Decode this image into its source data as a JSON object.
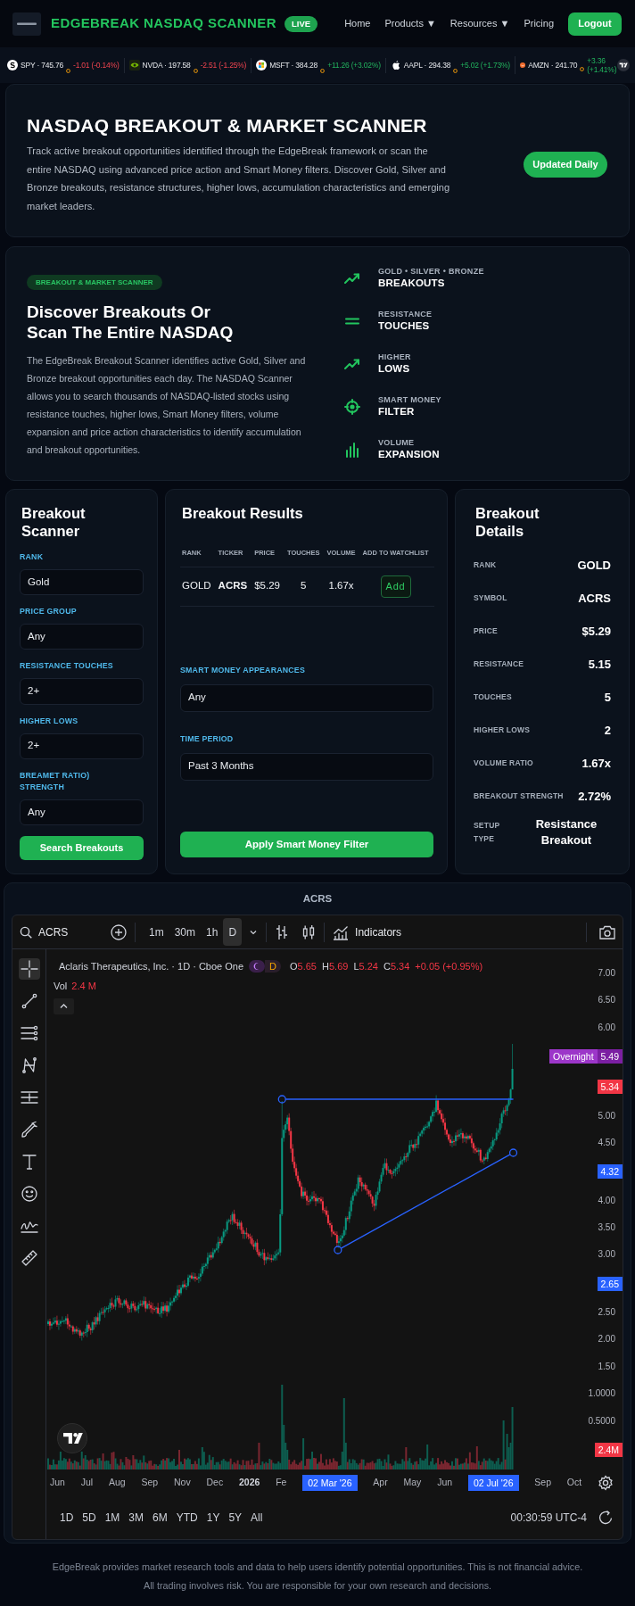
{
  "navbar": {
    "brand": "EDGEBREAK NASDAQ SCANNER",
    "badge": "LIVE",
    "links": [
      {
        "label": "Home"
      },
      {
        "label": "Products",
        "caret": "▼"
      },
      {
        "label": "Resources",
        "caret": "▼"
      },
      {
        "label": "Pricing"
      }
    ],
    "button": "Logout"
  },
  "ticker": [
    {
      "kind": "disc",
      "quote": "SPY · 745.76",
      "change": "-1.01 (-0.14%)",
      "falling": true
    },
    {
      "kind": "eye",
      "quote": "NVDA · 197.58",
      "change": "-2.51 (-1.25%)",
      "falling": true
    },
    {
      "kind": "squares",
      "quote": "MSFT · 384.28",
      "change": "+11.26 (+3.02%)",
      "falling": false
    },
    {
      "kind": "apple",
      "quote": "AAPL · 294.38",
      "change": "+5.02 (+1.73%)",
      "falling": false
    },
    {
      "kind": "smile",
      "quote": "AMZN · 241.70",
      "change": "+3.36 (+1.41%)",
      "falling": false
    }
  ],
  "hero": {
    "title": "NASDAQ BREAKOUT & MARKET SCANNER",
    "text": "Track active breakout opportunities identified through the EdgeBreak framework or scan the entire NASDAQ using advanced price action and Smart Money filters. Discover Gold, Silver and Bronze breakouts, resistance structures, higher lows, accumulation characteristics and emerging market leaders.",
    "badge": "Updated Daily"
  },
  "discover": {
    "tag": "BREAKOUT & MARKET SCANNER",
    "heading": "Discover Breakouts Or Scan The Entire NASDAQ",
    "text": "The EdgeBreak Breakout Scanner identifies active Gold, Silver and Bronze breakout opportunities each day. The NASDAQ Scanner allows you to search thousands of NASDAQ-listed stocks using resistance touches, higher lows, Smart Money filters, volume expansion and price action characteristics to identify accumulation and breakout opportunities.",
    "features": [
      {
        "kind": "trend",
        "caption": "GOLD • SILVER • BRONZE",
        "label": "BREAKOUTS"
      },
      {
        "kind": "equals",
        "caption": "RESISTANCE",
        "label": "TOUCHES"
      },
      {
        "kind": "trend",
        "caption": "HIGHER",
        "label": "LOWS"
      },
      {
        "kind": "target",
        "caption": "SMART MONEY",
        "label": "FILTER"
      },
      {
        "kind": "bars",
        "caption": "VOLUME",
        "label": "EXPANSION"
      }
    ]
  },
  "scanner": {
    "title": "Breakout Scanner",
    "filters": [
      {
        "label": "RANK",
        "value": "Gold"
      },
      {
        "label": "PRICE GROUP",
        "value": "Any"
      },
      {
        "label": "RESISTANCE TOUCHES",
        "value": "2+"
      },
      {
        "label": "HIGHER LOWS",
        "value": "2+"
      },
      {
        "label": "BREAMET RATIO) STRENGTH",
        "value": "Any"
      }
    ],
    "button": "Search Breakouts"
  },
  "results": {
    "title": "Breakout Results",
    "columns": [
      "RANK",
      "TICKER",
      "PRICE",
      "TOUCHES",
      "VOLUME",
      "ADD TO WATCHLIST"
    ],
    "rows": [
      {
        "cells": [
          "GOLD",
          "ACRS",
          "$5.29",
          "5",
          "1.67x"
        ],
        "action": "Add"
      }
    ],
    "filters": [
      {
        "label": "SMART MONEY APPEARANCES",
        "value": "Any"
      },
      {
        "label": "TIME PERIOD",
        "value": "Past 3 Months"
      }
    ],
    "button": "Apply Smart Money Filter"
  },
  "details": {
    "title": "Breakout Details",
    "rows": [
      {
        "label": "RANK",
        "value": "GOLD"
      },
      {
        "label": "SYMBOL",
        "value": "ACRS"
      },
      {
        "label": "PRICE",
        "value": "$5.29"
      },
      {
        "label": "RESISTANCE",
        "value": "5.15"
      },
      {
        "label": "TOUCHES",
        "value": "5"
      },
      {
        "label": "HIGHER LOWS",
        "value": "2"
      },
      {
        "label": "VOLUME RATIO",
        "value": "1.67x"
      },
      {
        "label": "BREAKOUT STRENGTH",
        "value": "2.72%"
      },
      {
        "label": "SETUP TYPE",
        "value": "Resistance Breakout"
      }
    ]
  },
  "chart": {
    "title": "ACRS",
    "symbol": "ACRS",
    "intervals": [
      {
        "label": "1m",
        "selected": false
      },
      {
        "label": "30m",
        "selected": false
      },
      {
        "label": "1h",
        "selected": false
      },
      {
        "label": "D",
        "selected": true
      }
    ],
    "indicators": "Indicators",
    "tools": [
      {
        "kind": "crosshair",
        "selected": true
      },
      {
        "kind": "line",
        "selected": false
      },
      {
        "kind": "levels",
        "selected": false
      },
      {
        "kind": "pattern",
        "selected": false
      },
      {
        "kind": "crosslines",
        "selected": false
      },
      {
        "kind": "brush",
        "selected": false
      },
      {
        "kind": "text",
        "selected": false
      },
      {
        "kind": "emoji",
        "selected": false
      },
      {
        "kind": "scribble",
        "selected": false
      },
      {
        "kind": "ruler",
        "selected": false
      }
    ],
    "legend": {
      "name": "Aclaris Therapeutics, Inc. · 1D · Cboe One",
      "badge": "D",
      "falling": true,
      "ohlc": [
        {
          "label": "O",
          "value": "5.65"
        },
        {
          "label": "H",
          "value": "5.69"
        },
        {
          "label": "L",
          "value": "5.24"
        },
        {
          "label": "C",
          "value": "5.34"
        }
      ],
      "change": "+0.05 (+0.95%)",
      "volume_label": "Vol",
      "volume_value": "2.4 M"
    },
    "price_axis": [
      {
        "kind": "tick",
        "text": "7.00"
      },
      {
        "kind": "tick",
        "text": "6.50"
      },
      {
        "kind": "tick",
        "text": "6.00"
      },
      {
        "kind": "tag",
        "label": "Overnight",
        "text": "5.49",
        "color": "#7b1fa2"
      },
      {
        "kind": "tag",
        "text": "5.34",
        "color": "#f23645"
      },
      {
        "kind": "tick",
        "text": "5.00"
      },
      {
        "kind": "tick",
        "text": "4.50"
      },
      {
        "kind": "tag",
        "text": "4.32",
        "color": "#2962ff"
      },
      {
        "kind": "tick",
        "text": "4.00"
      },
      {
        "kind": "tick",
        "text": "3.50"
      },
      {
        "kind": "tick",
        "text": "3.00"
      },
      {
        "kind": "tag",
        "text": "2.65",
        "color": "#2962ff"
      },
      {
        "kind": "tick",
        "text": "2.50"
      },
      {
        "kind": "tick",
        "text": "2.00"
      },
      {
        "kind": "tick",
        "text": "1.50"
      },
      {
        "kind": "tick",
        "text": "1.0000"
      },
      {
        "kind": "tick",
        "text": "0.5000"
      },
      {
        "kind": "tag",
        "text": "2.4M",
        "color": "#f23645"
      }
    ],
    "time_axis": [
      {
        "kind": "month",
        "text": "Jun"
      },
      {
        "kind": "month",
        "text": "Jul"
      },
      {
        "kind": "month",
        "text": "Aug"
      },
      {
        "kind": "month",
        "text": "Sep"
      },
      {
        "kind": "month",
        "text": "Nov"
      },
      {
        "kind": "month",
        "text": "Dec"
      },
      {
        "kind": "year",
        "text": "2026"
      },
      {
        "kind": "month",
        "text": "Fe"
      },
      {
        "kind": "tag",
        "text": "02 Mar '26"
      },
      {
        "kind": "month",
        "text": "Apr"
      },
      {
        "kind": "month",
        "text": "May"
      },
      {
        "kind": "month",
        "text": "Jun"
      },
      {
        "kind": "tag",
        "text": "02 Jul '26"
      },
      {
        "kind": "month",
        "text": "Sep"
      },
      {
        "kind": "month",
        "text": "Oct"
      }
    ],
    "ranges": [
      "1D",
      "5D",
      "1M",
      "3M",
      "6M",
      "YTD",
      "1Y",
      "5Y",
      "All"
    ],
    "clock": "00:30:59 UTC-4"
  },
  "footer": {
    "lines": [
      "EdgeBreak provides market research tools and data to help users identify potential opportunities. This is not financial advice.",
      "All trading involves risk. You are responsible for your own research and decisions."
    ]
  }
}
